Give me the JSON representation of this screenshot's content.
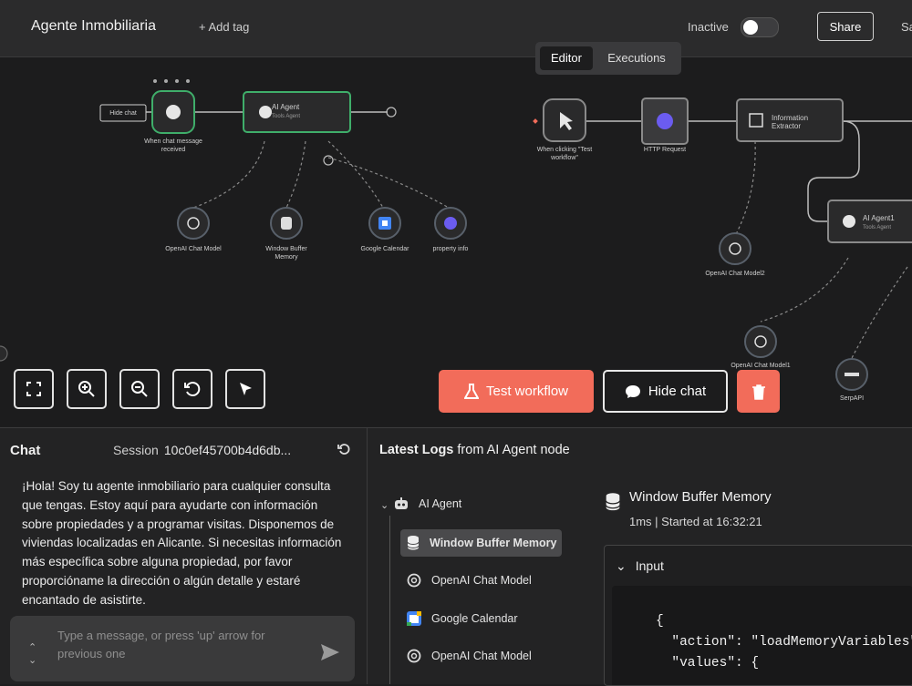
{
  "header": {
    "workflow_name": "Agente Inmobiliaria",
    "add_tag": "+ Add tag",
    "status_label": "Inactive",
    "share_label": "Share",
    "save_label_cut": "Sa"
  },
  "tabs": {
    "editor": "Editor",
    "executions": "Executions"
  },
  "canvas": {
    "nodes": {
      "hide_chat_tag": "Hide chat",
      "chat_trigger": "When chat message received",
      "ai_agent": "AI Agent",
      "ai_agent_sub": "Tools Agent",
      "openai_chat_model": "OpenAI Chat Model",
      "window_buffer_memory": "Window Buffer Memory",
      "google_calendar": "Google Calendar",
      "property_info": "property info",
      "manual_trigger": "When clicking \"Test workflow\"",
      "http_request": "HTTP Request",
      "information_extractor": "Information Extractor",
      "openai_chat_model2": "OpenAI Chat Model2",
      "ai_agent1": "AI Agent1",
      "ai_agent1_sub": "Tools Agent",
      "openai_chat_model1": "OpenAI Chat Model1",
      "serpapi": "SerpAPI"
    },
    "test_workflow_label": "Test workflow",
    "hide_chat_label": "Hide chat"
  },
  "chat": {
    "title": "Chat",
    "session_label": "Session",
    "session_id": "10c0ef45700b4d6db...",
    "message": "¡Hola! Soy tu agente inmobiliario para cualquier consulta que tengas. Estoy aquí para ayudarte con información sobre propiedades y a programar visitas. Disponemos de viviendas localizadas en Alicante. Si necesitas información más específica sobre alguna propiedad, por favor proporcióname la dirección o algún detalle y estaré encantado de asistirte.",
    "input_placeholder": "Type a message, or press 'up' arrow for previous one"
  },
  "logs": {
    "title_bold": "Latest Logs",
    "title_rest": "from AI Agent node",
    "tree": [
      {
        "label": "AI Agent"
      },
      {
        "label": "Window Buffer Memory"
      },
      {
        "label": "OpenAI Chat Model"
      },
      {
        "label": "Google Calendar"
      },
      {
        "label": "OpenAI Chat Model"
      }
    ],
    "detail_title": "Window Buffer Memory",
    "detail_sub": "1ms | Started at 16:32:21",
    "input_label": "Input",
    "code_lines": [
      "{",
      "  \"action\": \"loadMemoryVariables\",",
      "  \"values\": {"
    ]
  },
  "colors": {
    "accent": "#f26c5a",
    "node_selected": "#3fae6a",
    "background": "#1c1c1d"
  }
}
